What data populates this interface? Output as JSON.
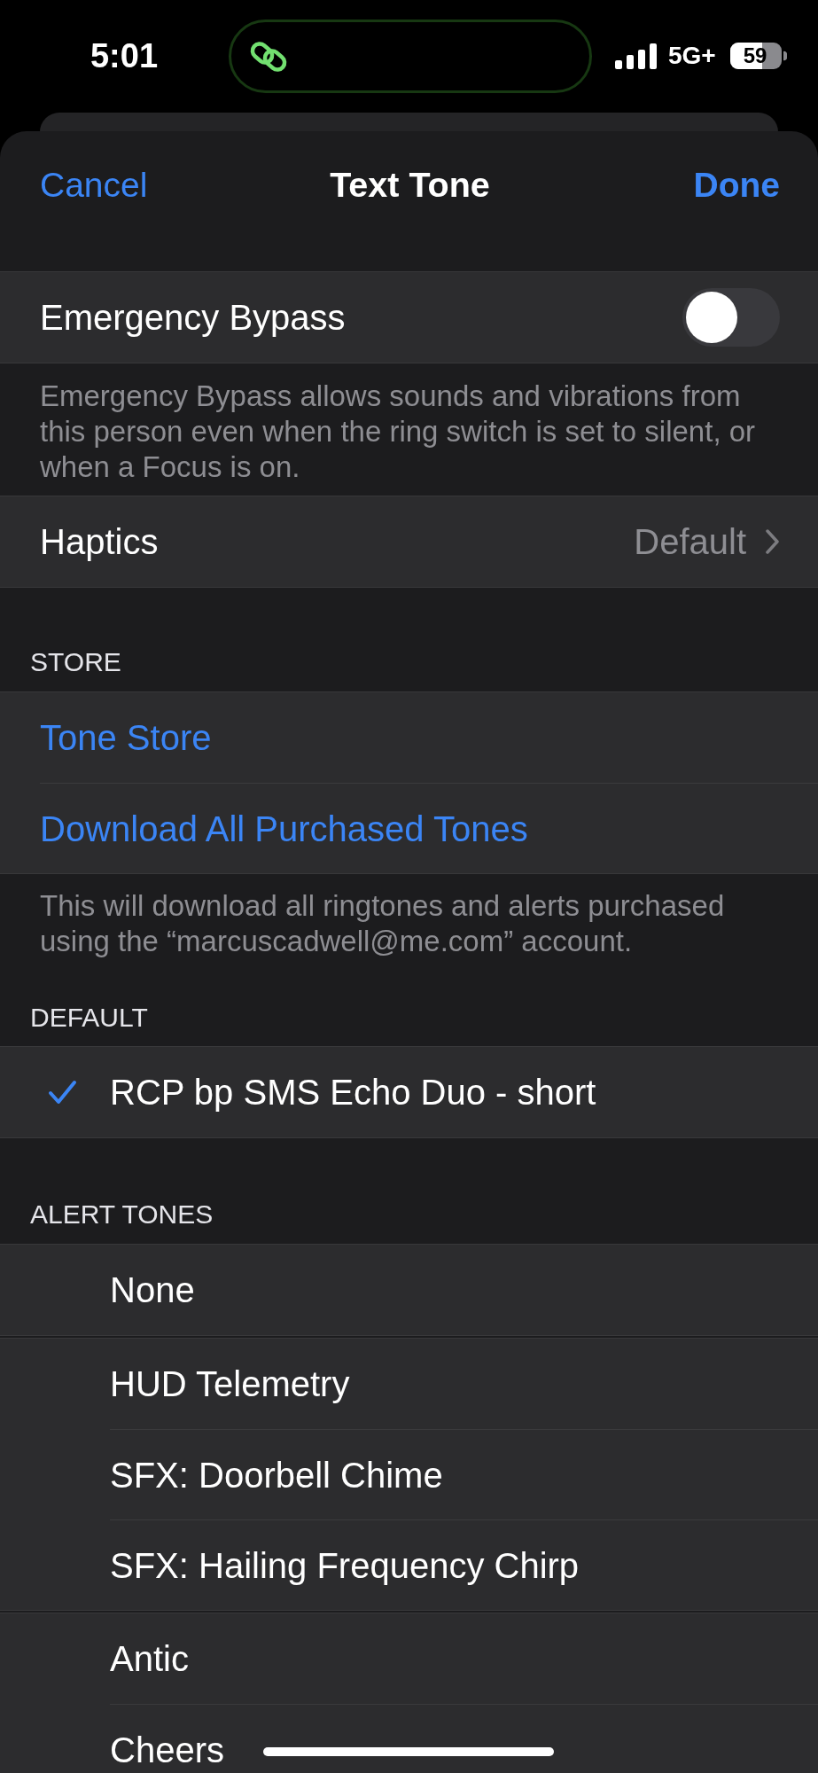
{
  "status_bar": {
    "time": "5:01",
    "network": "5G+",
    "battery": "59"
  },
  "nav": {
    "cancel": "Cancel",
    "title": "Text Tone",
    "done": "Done"
  },
  "emergency_bypass": {
    "label": "Emergency Bypass",
    "on": false,
    "footer": "Emergency Bypass allows sounds and vibrations from this person even when the ring switch is set to silent, or when a Focus is on."
  },
  "haptics": {
    "label": "Haptics",
    "value": "Default"
  },
  "store": {
    "header": "STORE",
    "links": [
      "Tone Store",
      "Download All Purchased Tones"
    ],
    "footer": "This will download all ringtones and alerts purchased using the “marcuscadwell@me.com” account."
  },
  "default": {
    "header": "DEFAULT",
    "tones": [
      {
        "name": "RCP bp SMS Echo Duo - short",
        "selected": true
      }
    ]
  },
  "alert_tones": {
    "header": "ALERT TONES",
    "groups": [
      {
        "tones": [
          {
            "name": "None",
            "selected": false
          }
        ]
      },
      {
        "tones": [
          {
            "name": "HUD Telemetry",
            "selected": false
          },
          {
            "name": "SFX: Doorbell Chime",
            "selected": false
          },
          {
            "name": "SFX: Hailing Frequency Chirp",
            "selected": false
          }
        ]
      },
      {
        "tones": [
          {
            "name": "Antic",
            "selected": false
          },
          {
            "name": "Cheers",
            "selected": false
          }
        ]
      }
    ]
  }
}
